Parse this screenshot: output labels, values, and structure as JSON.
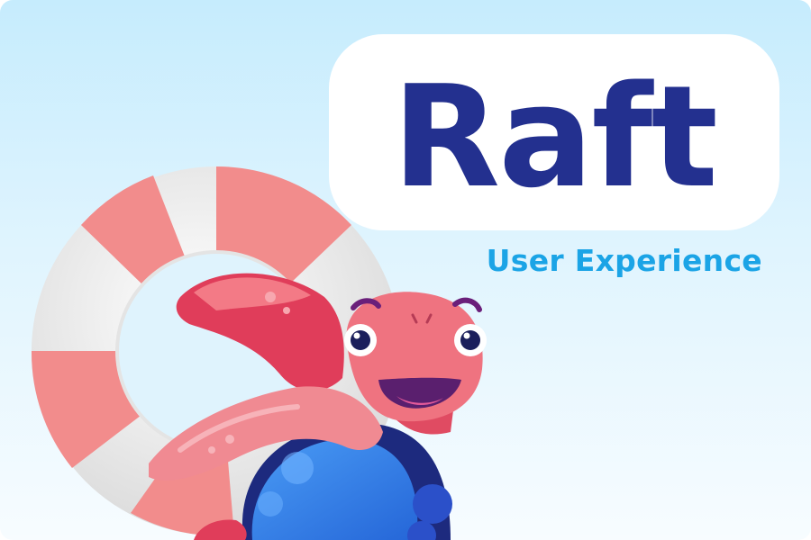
{
  "brand": {
    "title": "Raft",
    "subtitle": "User Experience"
  },
  "colors": {
    "title_fill": "#23308f",
    "title_outline": "#ffffff",
    "subtitle": "#1ba4e6",
    "background_top": "#c6ecfd",
    "background_bottom": "#f7fcff",
    "lifebuoy_red": "#f08f8f",
    "lifebuoy_white": "#f3f3f3",
    "turtle_skin": "#ef6f78",
    "turtle_shell": "#2f79e8",
    "turtle_shell_dark": "#1d2a7e"
  },
  "illustration": {
    "lifebuoy_icon": "lifebuoy-icon",
    "mascot_icon": "turtle-mascot-icon"
  }
}
